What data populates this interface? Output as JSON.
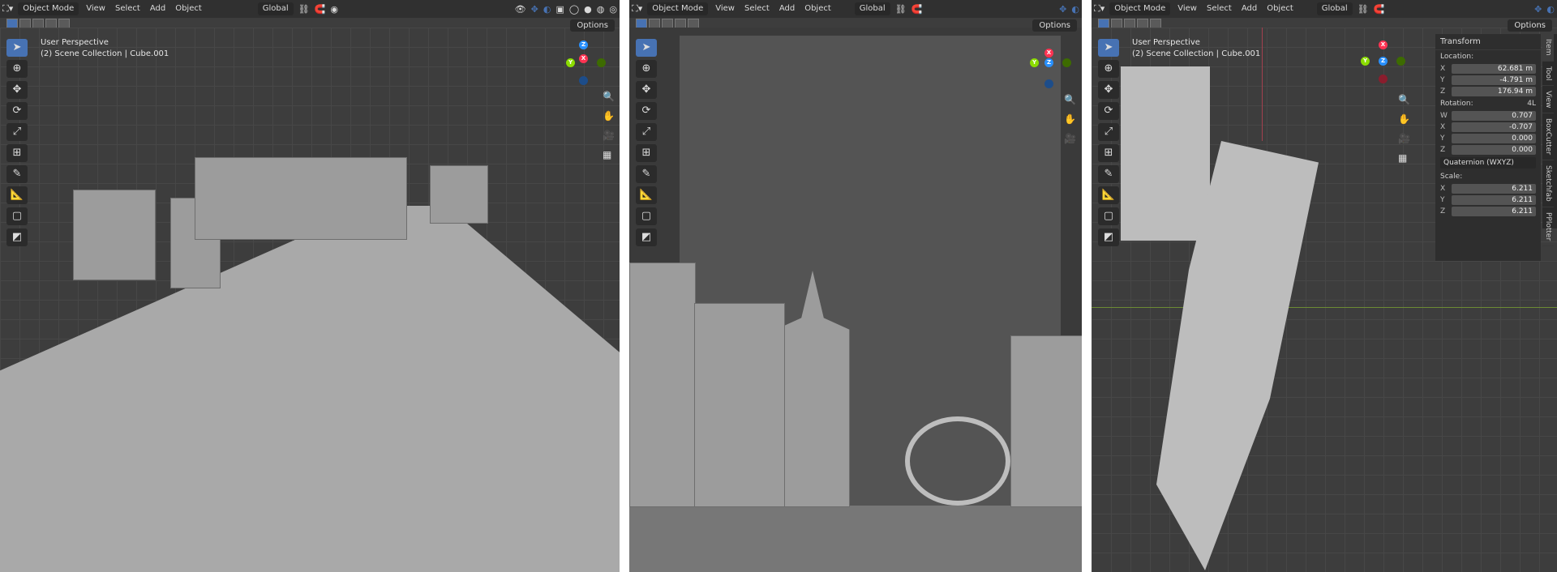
{
  "panels": [
    {
      "mode": "Object Mode",
      "menus": [
        "View",
        "Select",
        "Add",
        "Object"
      ],
      "transform_orientation": "Global",
      "options": "Options",
      "view_name": "User Perspective",
      "collection": "(2) Scene Collection | Cube.001"
    },
    {
      "mode": "Object Mode",
      "menus": [
        "View",
        "Select",
        "Add",
        "Object"
      ],
      "transform_orientation": "Global",
      "options": "Options"
    },
    {
      "mode": "Object Mode",
      "menus": [
        "View",
        "Select",
        "Add",
        "Object"
      ],
      "transform_orientation": "Global",
      "options": "Options",
      "view_name": "User Perspective",
      "collection": "(2) Scene Collection | Cube.001"
    }
  ],
  "sidebar": {
    "title": "Transform",
    "location_label": "Location:",
    "location": [
      {
        "axis": "X",
        "value": "62.681 m"
      },
      {
        "axis": "Y",
        "value": "-4.791 m"
      },
      {
        "axis": "Z",
        "value": "176.94 m"
      }
    ],
    "rotation_label": "Rotation:",
    "rotation_mode_tag": "4L",
    "rotation": [
      {
        "axis": "W",
        "value": "0.707"
      },
      {
        "axis": "X",
        "value": "-0.707"
      },
      {
        "axis": "Y",
        "value": "0.000"
      },
      {
        "axis": "Z",
        "value": "0.000"
      }
    ],
    "rotation_mode": "Quaternion (WXYZ)",
    "scale_label": "Scale:",
    "scale": [
      {
        "axis": "X",
        "value": "6.211"
      },
      {
        "axis": "Y",
        "value": "6.211"
      },
      {
        "axis": "Z",
        "value": "6.211"
      }
    ],
    "tabs": [
      "Item",
      "Tool",
      "View",
      "BoxCutter",
      "Sketchfab",
      "PPlotter"
    ]
  },
  "gizmo": {
    "x": "X",
    "y": "Y",
    "z": "Z"
  },
  "colors": {
    "x_axis": "#ff3352",
    "y_axis": "#8bdc00",
    "z_axis": "#2890ff",
    "accent": "#4772b3"
  }
}
